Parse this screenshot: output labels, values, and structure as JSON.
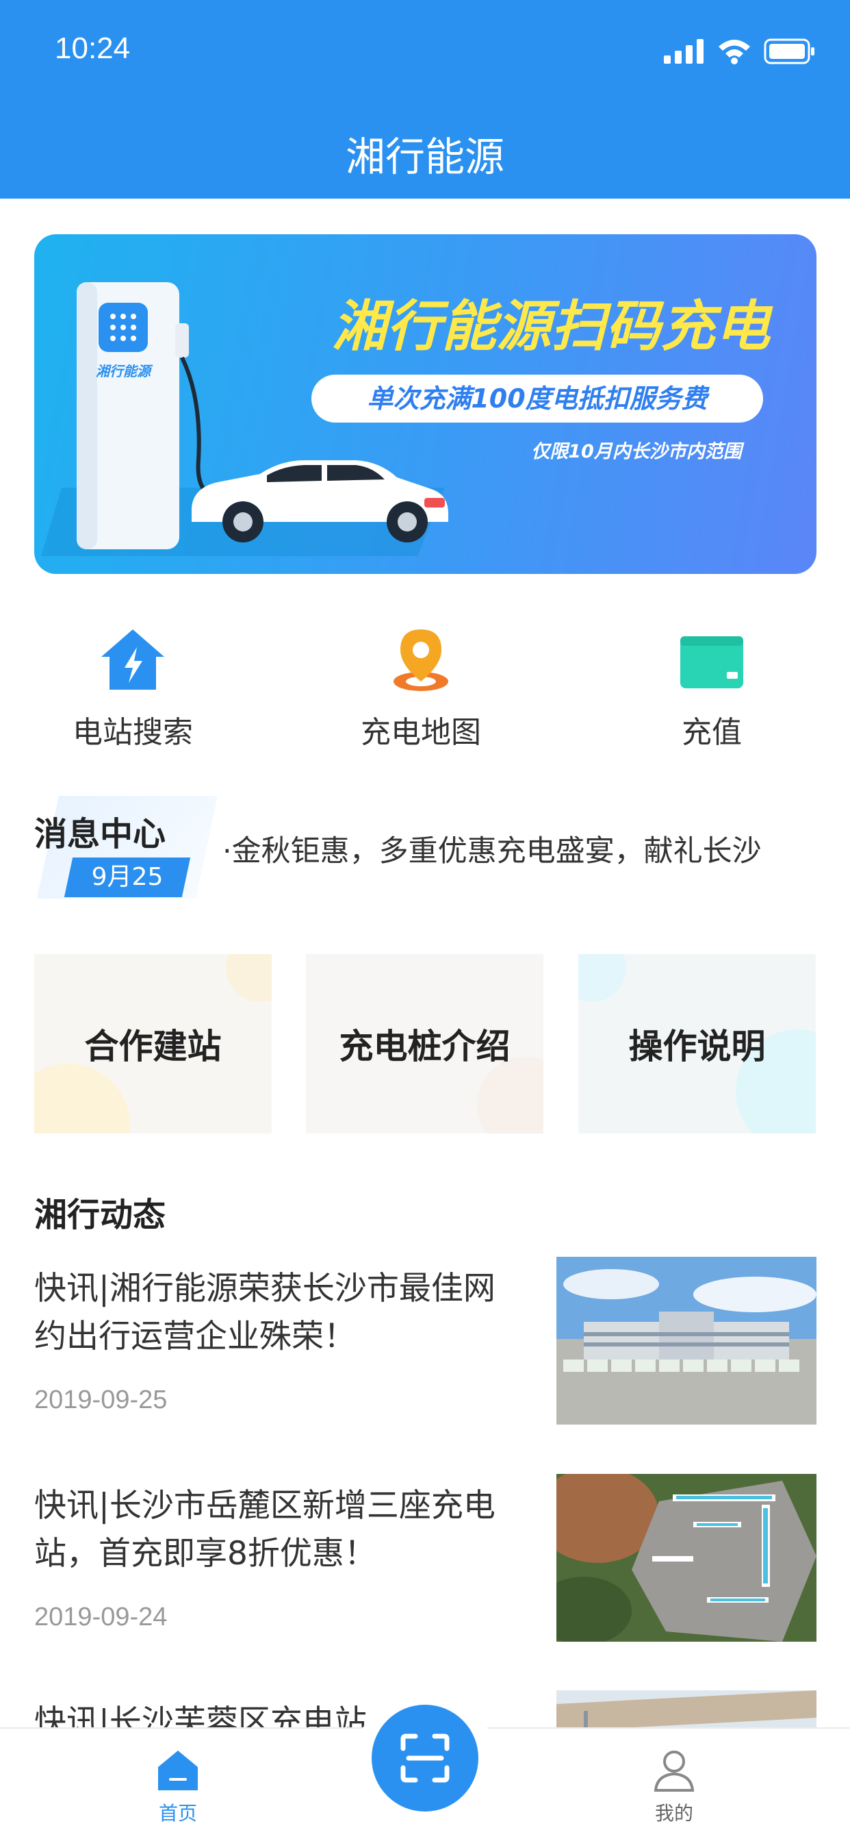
{
  "status_bar": {
    "time": "10:24"
  },
  "app_title": "湘行能源",
  "banner": {
    "title": "湘行能源扫码充电",
    "pill": "单次充满100度电抵扣服务费",
    "note": "仅限10月内长沙市内范围",
    "charger_brand": "湘行能源"
  },
  "quick_actions": [
    {
      "label": "电站搜索",
      "icon": "house-lightning-icon"
    },
    {
      "label": "充电地图",
      "icon": "map-pin-icon"
    },
    {
      "label": "充值",
      "icon": "wallet-card-icon"
    }
  ],
  "message_center": {
    "title": "消息中心",
    "date": "9月25",
    "text": "·金秋钜惠，多重优惠充电盛宴，献礼长沙"
  },
  "cards": [
    {
      "label": "合作建站"
    },
    {
      "label": "充电桩介绍"
    },
    {
      "label": "操作说明"
    }
  ],
  "news": {
    "heading": "湘行动态",
    "items": [
      {
        "title": "快讯|湘行能源荣获长沙市最佳网约出行运营企业殊荣！",
        "date": "2019-09-25"
      },
      {
        "title": "快讯|长沙市岳麓区新增三座充电站，首充即享8折优惠！",
        "date": "2019-09-24"
      },
      {
        "title": "快讯|长沙芙蓉区充电站",
        "date": ""
      }
    ]
  },
  "tabbar": {
    "home_label": "首页",
    "mine_label": "我的",
    "scan_icon": "scan-icon"
  },
  "colors": {
    "primary": "#2a91f0",
    "banner_title": "#ffe94a"
  }
}
